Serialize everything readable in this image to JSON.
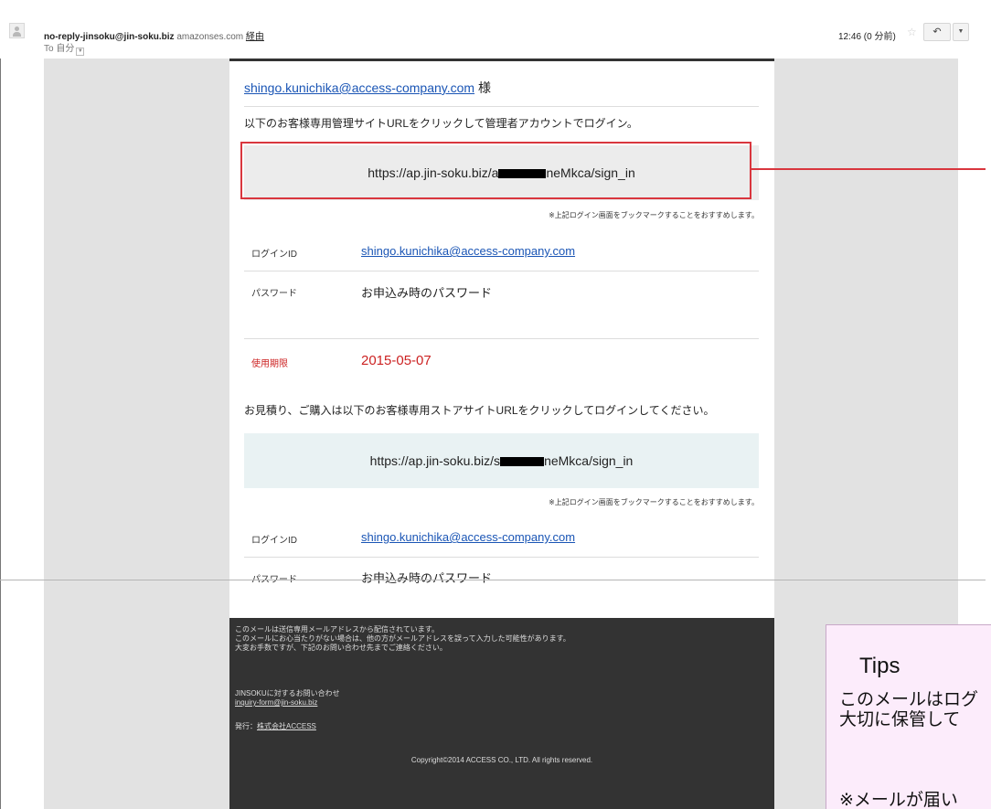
{
  "header": {
    "sender_address": "no-reply-jinsoku@jin-soku.biz",
    "via_domain": "amazonses.com",
    "via_label": "経由",
    "to_label": "To 自分",
    "time": "12:46 (0 分前)",
    "star_icon": "☆",
    "reply_icon": "↶",
    "more_icon": "▼"
  },
  "email": {
    "salutation_email": "shingo.kunichika@access-company.com",
    "salutation_suffix": "様",
    "admin_intro": "以下のお客様専用管理サイトURLをクリックして管理者アカウントでログイン。",
    "admin_url_part1": "https://ap.jin-soku.biz/a",
    "admin_url_part2": "neMkca/sign_in",
    "bookmark_note": "※上記ログイン画面をブックマークすることをおすすめします。",
    "login_id_label": "ログインID",
    "login_id_value": "shingo.kunichika@access-company.com",
    "password_label": "パスワード",
    "password_value": "お申込み時のパスワード",
    "expiry_label": "使用期限",
    "expiry_value": "2015-05-07",
    "store_intro": "お見積り、ご購入は以下のお客様専用ストアサイトURLをクリックしてログインしてください。",
    "store_url_part1": "https://ap.jin-soku.biz/s",
    "store_url_part2": "neMkca/sign_in"
  },
  "footer": {
    "notice_line1": "このメールは送信専用メールアドレスから配信されています。",
    "notice_line2": "このメールにお心当たりがない場合は、他の方がメールアドレスを誤って入力した可能性があります。",
    "notice_line3": "大変お手数ですが、下記のお問い合わせ先までご連絡ください。",
    "contact_heading": "JINSOKUに対するお問い合わせ",
    "contact_email": "inquiry-form@jin-soku.biz",
    "publisher_label": "発行：",
    "publisher_name": "株式会社ACCESS",
    "copyright": "Copyright©2014 ACCESS CO., LTD. All rights reserved."
  },
  "tips": {
    "title": "Tips",
    "line1": "このメールはログ",
    "line2": "大切に保管して",
    "line3": "※メールが届い"
  },
  "colors": {
    "highlight": "#d9363e",
    "link": "#1a55b5",
    "expiry": "#cc2222",
    "tips_bg": "#fcecfb"
  }
}
